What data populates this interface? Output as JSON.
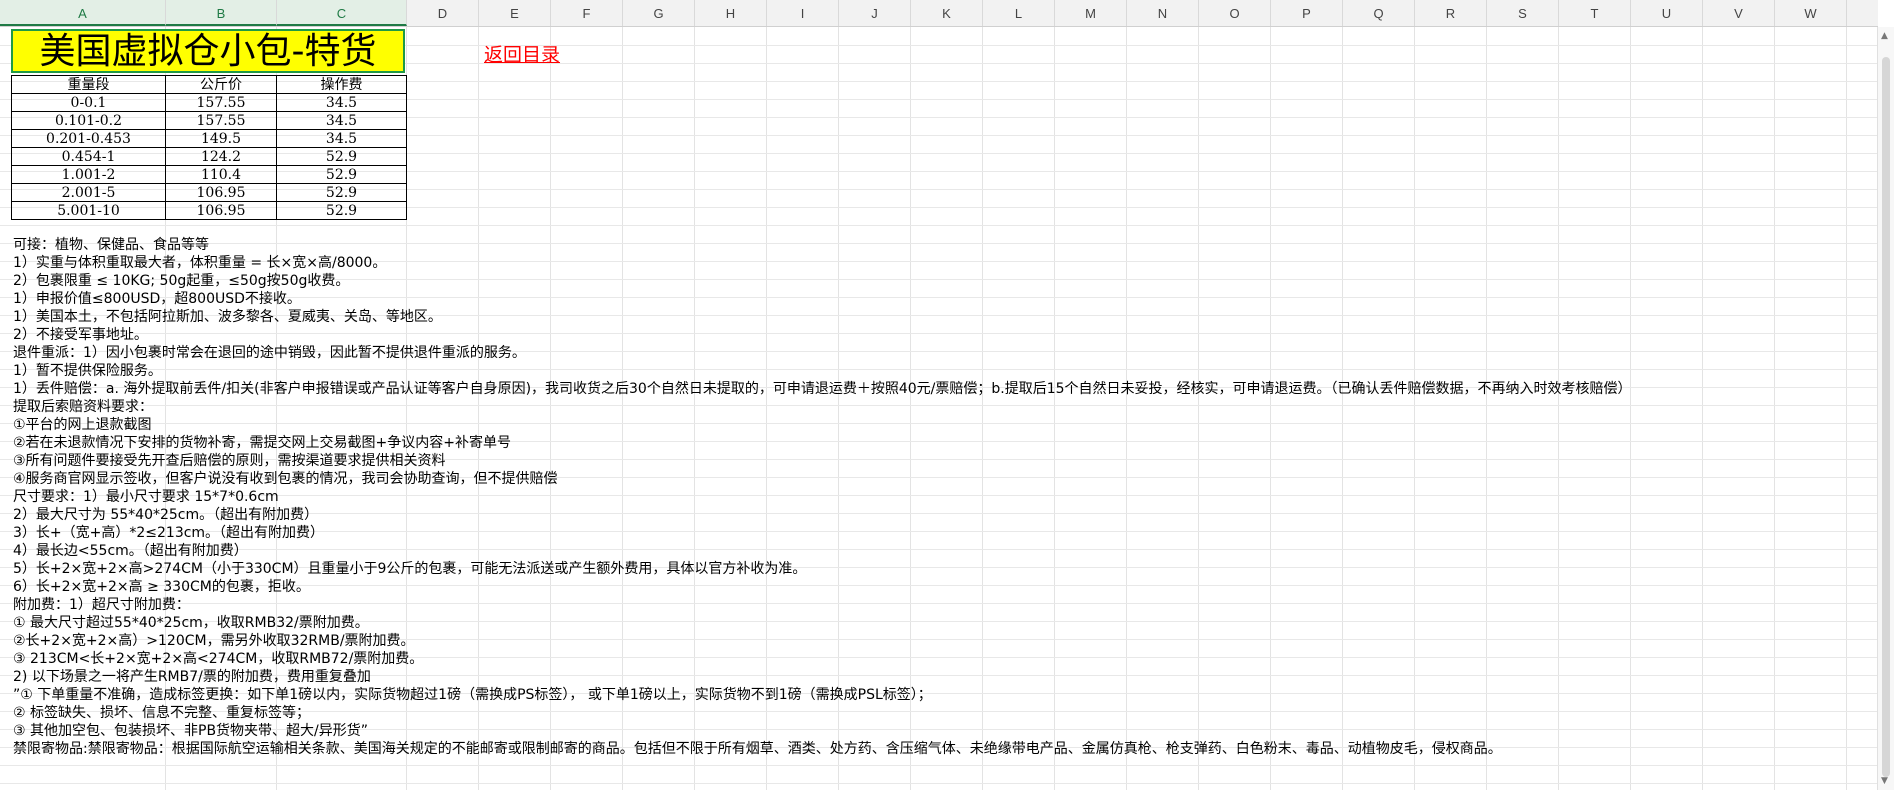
{
  "columns": [
    "A",
    "B",
    "C",
    "D",
    "E",
    "F",
    "G",
    "H",
    "I",
    "J",
    "K",
    "L",
    "M",
    "N",
    "O",
    "P",
    "Q",
    "R",
    "S",
    "T",
    "U",
    "V",
    "W"
  ],
  "title": "美国虚拟仓小包-特货",
  "back_link": "返回目录",
  "table": {
    "headers": [
      "重量段",
      "公斤价",
      "操作费"
    ],
    "rows": [
      [
        "0-0.1",
        "157.55",
        "34.5"
      ],
      [
        "0.101-0.2",
        "157.55",
        "34.5"
      ],
      [
        "0.201-0.453",
        "149.5",
        "34.5"
      ],
      [
        "0.454-1",
        "124.2",
        "52.9"
      ],
      [
        "1.001-2",
        "110.4",
        "52.9"
      ],
      [
        "2.001-5",
        "106.95",
        "52.9"
      ],
      [
        "5.001-10",
        "106.95",
        "52.9"
      ]
    ]
  },
  "notes": [
    "可接：植物、保健品、食品等等",
    "1）实重与体积重取最大者，体积重量 = 长×宽×高/8000。",
    "2）包裹限重 ≤ 10KG;  50g起重，≤50g按50g收费。",
    "1）申报价值≤800USD，超800USD不接收。",
    "1）美国本土，不包括阿拉斯加、波多黎各、夏威夷、关岛、等地区。",
    "2）不接受军事地址。",
    "退件重派：1）因小包裹时常会在退回的途中销毁，因此暂不提供退件重派的服务。",
    "1）暂不提供保险服务。",
    "1）丢件赔偿：a. 海外提取前丢件/扣关(非客户申报错误或产品认证等客户自身原因)，我司收货之后30个自然日未提取的，可申请退运费＋按照40元/票赔偿；b.提取后15个自然日未妥投，经核实，可申请退运费。（已确认丢件赔偿数据，不再纳入时效考核赔偿）",
    "提取后索赔资料要求：",
    "①平台的网上退款截图",
    "②若在未退款情况下安排的货物补寄，需提交网上交易截图+争议内容+补寄单号",
    "③所有问题件要接受先开查后赔偿的原则，需按渠道要求提供相关资料",
    "④服务商官网显示签收，但客户说没有收到包裹的情况，我司会协助查询，但不提供赔偿",
    "尺寸要求：1）最小尺寸要求 15*7*0.6cm",
    "2）最大尺寸为 55*40*25cm。（超出有附加费）",
    "3）长+（宽+高）*2≤213cm。（超出有附加费）",
    "4）最长边<55cm。（超出有附加费）",
    "5）长+2×宽+2×高>274CM（小于330CM）且重量小于9公斤的包裹，可能无法派送或产生额外费用，具体以官方补收为准。",
    "6）长+2×宽+2×高 ≥ 330CM的包裹，拒收。",
    "附加费：1）超尺寸附加费：",
    "① 最大尺寸超过55*40*25cm，收取RMB32/票附加费。",
    "②长+2×宽+2×高）>120CM，需另外收取32RMB/票附加费。",
    "③ 213CM<长+2×宽+2×高<274CM，收取RMB72/票附加费。",
    "2)   以下场景之一将产生RMB7/票的附加费，费用重复叠加",
    "”① 下单重量不准确，造成标签更换：如下单1磅以内，实际货物超过1磅（需换成PS标签）， 或下单1磅以上，实际货物不到1磅（需换成PSL标签）；",
    "② 标签缺失、损坏、信息不完整、重复标签等；",
    "③ 其他加空包、包装损坏、非PB货物夹带、超大/异形货”",
    "禁限寄物品:禁限寄物品：根据国际航空运输相关条款、美国海关规定的不能邮寄或限制邮寄的商品。包括但不限于所有烟草、酒类、处方药、含压缩气体、未绝缘带电产品、金属仿真枪、枪支弹药、白色粉末、毒品、动植物皮毛，侵权商品。"
  ]
}
